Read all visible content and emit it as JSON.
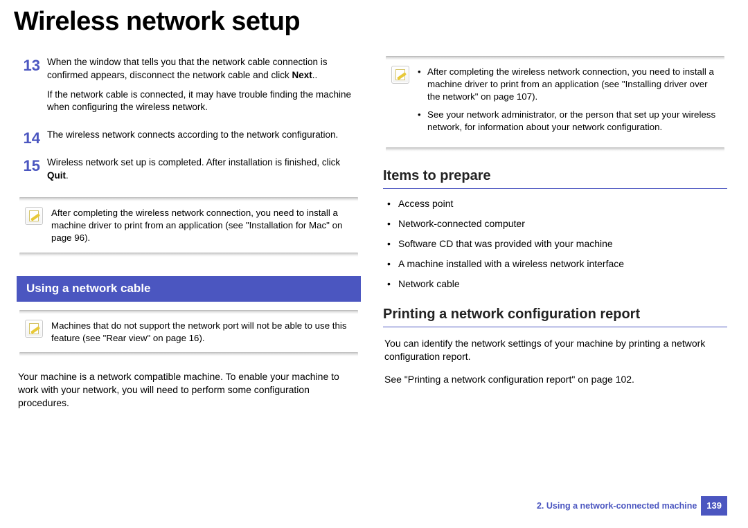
{
  "title": "Wireless network setup",
  "left": {
    "steps": [
      {
        "num": "13",
        "paras": [
          "When the window that tells you that the network cable connection is confirmed appears, disconnect the network cable and click <b>Next</b>..",
          "If the network cable is connected, it may have trouble finding the machine when configuring the wireless network."
        ]
      },
      {
        "num": "14",
        "paras": [
          "The wireless network connects according to the network configuration."
        ]
      },
      {
        "num": "15",
        "paras": [
          "Wireless network set up is completed. After installation is finished, click <b>Quit</b>."
        ]
      }
    ],
    "note1": "After completing the wireless network connection, you need to install a machine driver to print from an application (see \"Installation for Mac\" on page 96).",
    "band": "Using a network cable",
    "note2": "Machines that do not support the network port will not be able to use this feature (see \"Rear view\" on page 16).",
    "para": "Your machine is a network compatible machine. To enable your machine to work with your network, you will need to perform some configuration procedures."
  },
  "right": {
    "note_bullets": [
      "After completing the wireless network connection, you need to install a machine driver to print from an application (see \"Installing driver over the network\" on page 107).",
      "See your network administrator, or the person that set up your wireless network, for information about your network configuration."
    ],
    "items_heading": "Items to prepare",
    "items": [
      "Access point",
      "Network-connected computer",
      "Software CD that was provided with your machine",
      "A machine installed with a wireless network interface",
      "Network cable"
    ],
    "print_heading": "Printing a network configuration report",
    "print_p1": "You can identify the network settings of your machine by printing a network configuration report.",
    "print_p2": "See \"Printing a network configuration report\" on page 102."
  },
  "footer": {
    "chapter": "2.  Using a network-connected machine",
    "page": "139"
  }
}
